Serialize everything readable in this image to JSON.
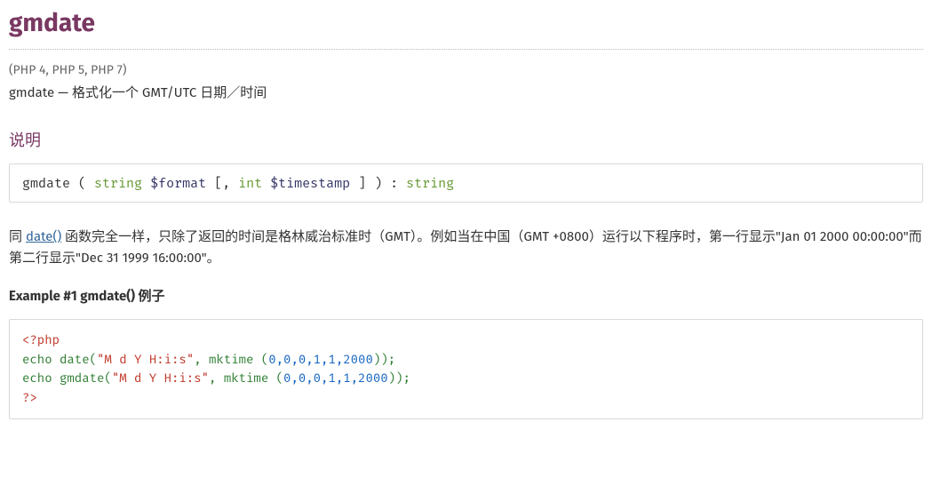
{
  "title": "gmdate",
  "versions": "(PHP 4, PHP 5, PHP 7)",
  "purpose": "gmdate — 格式化一个 GMT/UTC 日期／时间",
  "section_desc_heading": "说明",
  "synopsis": {
    "fn": "gmdate",
    "open": " ( ",
    "p1_type": "string",
    "p1_name": "$format",
    "mid": " [, ",
    "p2_type": "int",
    "p2_name": "$timestamp",
    "close": " ] ) : ",
    "ret_type": "string"
  },
  "para_prefix": "同 ",
  "para_link": "date()",
  "para_rest": " 函数完全一样，只除了返回的时间是格林威治标准时（GMT）。例如当在中国（GMT +0800）运行以下程序时，第一行显示\"Jan 01 2000 00:00:00\"而第二行显示\"Dec 31 1999 16:00:00\"。",
  "example_title": "Example #1 gmdate() 例子",
  "code": {
    "open_tag": "<?php",
    "l1": {
      "kw": "echo ",
      "fn": "date",
      "op": "(",
      "str": "\"M d Y H:i:s\"",
      "comma": ", ",
      "fn2": "mktime ",
      "op2": "(",
      "args": "0,0,0,1,1,2000",
      "cl": "));"
    },
    "l2": {
      "kw": "echo ",
      "fn": "gmdate",
      "op": "(",
      "str": "\"M d Y H:i:s\"",
      "comma": ", ",
      "fn2": "mktime ",
      "op2": "(",
      "args": "0,0,0,1,1,2000",
      "cl": "));"
    },
    "close_tag": "?>"
  }
}
